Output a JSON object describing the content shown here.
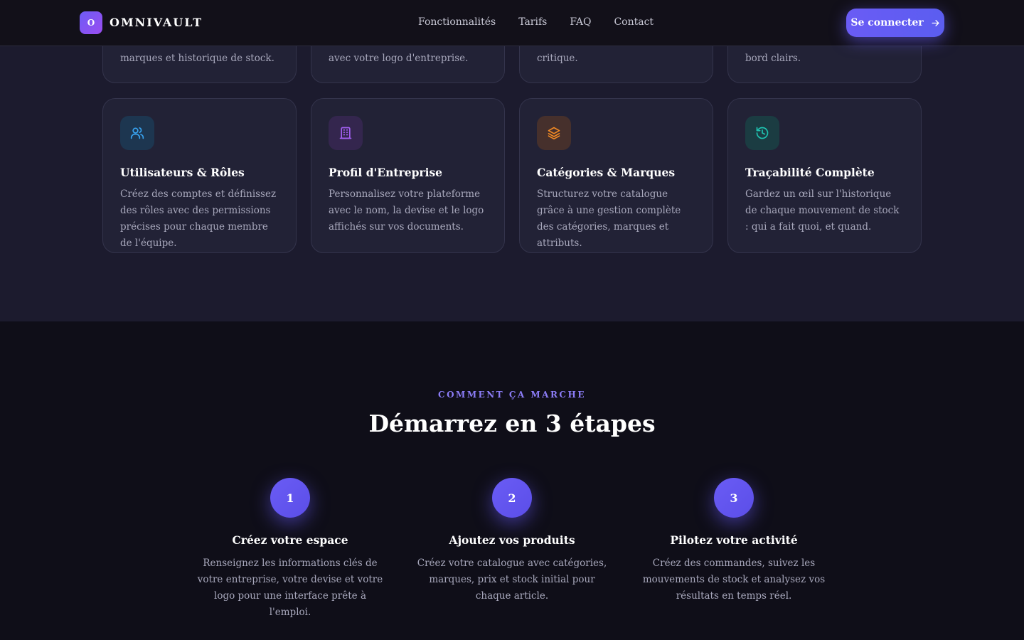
{
  "nav": {
    "logo_letter": "O",
    "brand": "OMNIVAULT",
    "links": [
      "Fonctionnalités",
      "Tarifs",
      "FAQ",
      "Contact"
    ],
    "login_label": "Se connecter",
    "login_icon": "arrow-right-icon"
  },
  "features": {
    "top_row_partial": [
      "marques et historique de stock.",
      "avec votre logo d'entreprise.",
      "critique.",
      "bord clairs."
    ],
    "cards": [
      {
        "icon": "users-icon",
        "icon_color": "#38a3f0",
        "icon_bg": "#1d3650",
        "title": "Utilisateurs & Rôles",
        "description": "Créez des comptes et définissez des rôles avec des permissions précises pour chaque membre de l'équipe."
      },
      {
        "icon": "building-icon",
        "icon_color": "#a25ff0",
        "icon_bg": "#34264e",
        "title": "Profil d'Entreprise",
        "description": "Personnalisez votre plateforme avec le nom, la devise et le logo affichés sur vos documents."
      },
      {
        "icon": "layers-icon",
        "icon_color": "#f28a24",
        "icon_bg": "#46302c",
        "title": "Catégories & Marques",
        "description": "Structurez votre catalogue grâce à une gestion complète des catégories, marques et attributs."
      },
      {
        "icon": "history-icon",
        "icon_color": "#1fc2b0",
        "icon_bg": "#1b3c42",
        "title": "Traçabilité Complète",
        "description": "Gardez un œil sur l'historique de chaque mouvement de stock : qui a fait quoi, et quand."
      }
    ]
  },
  "how": {
    "eyebrow": "COMMENT ÇA MARCHE",
    "title": "Démarrez en 3 étapes",
    "steps": [
      {
        "number": "1",
        "title": "Créez votre espace",
        "description": "Renseignez les informations clés de votre entreprise, votre devise et votre logo pour une interface prête à l'emploi."
      },
      {
        "number": "2",
        "title": "Ajoutez vos produits",
        "description": "Créez votre catalogue avec catégories, marques, prix et stock initial pour chaque article."
      },
      {
        "number": "3",
        "title": "Pilotez votre activité",
        "description": "Créez des commandes, suivez les mouvements de stock et analysez vos résultats en temps réel."
      }
    ]
  },
  "colors": {
    "accent": "#6a5cf5",
    "eyebrow": "#8b7cf6",
    "features_bg": "#1c1b2e",
    "page_bg": "#0f0e18"
  }
}
